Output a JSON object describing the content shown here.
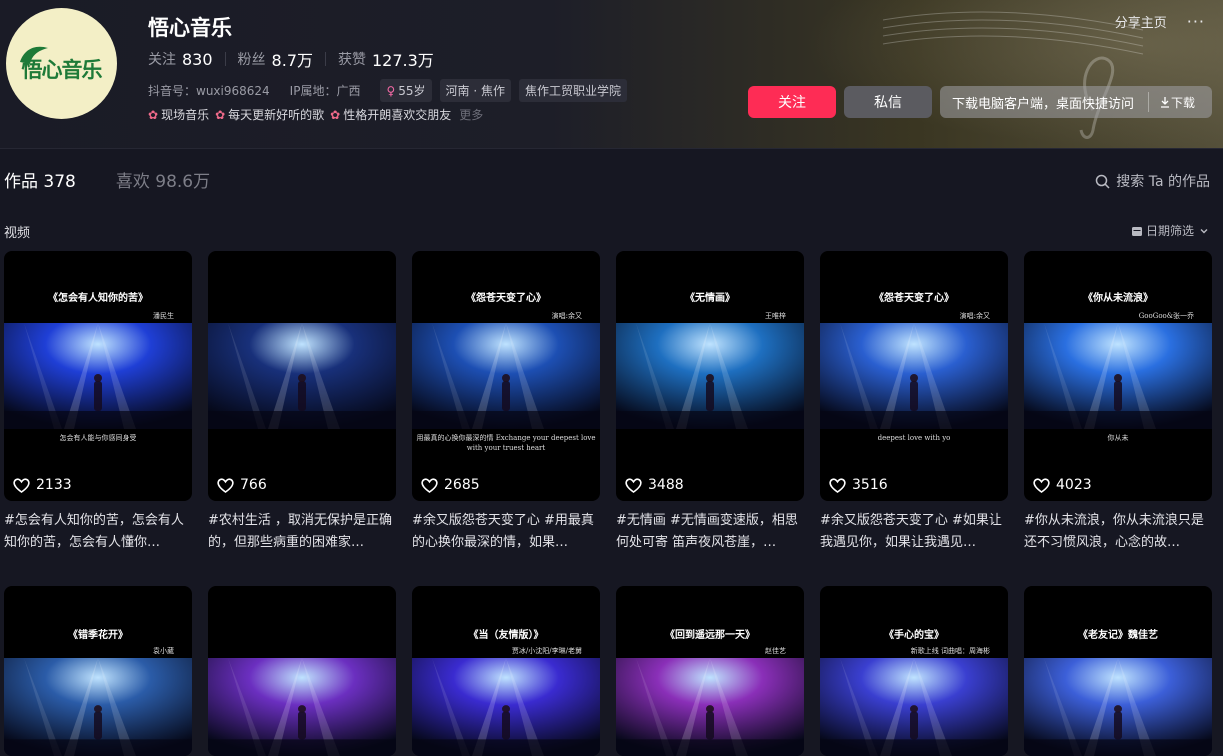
{
  "profile": {
    "name": "悟心音乐",
    "avatar_text": "悟心音乐",
    "stats": [
      {
        "label": "关注",
        "value": "830"
      },
      {
        "label": "粉丝",
        "value": "8.7万"
      },
      {
        "label": "获赞",
        "value": "127.3万"
      }
    ],
    "douyin_id": "抖音号：wuxi968624",
    "ip_location": "IP属地：广西",
    "tags": {
      "age": "55岁",
      "region": "河南 · 焦作",
      "school": "焦作工贸职业学院"
    },
    "bio_items": [
      "现场音乐",
      "每天更新好听的歌",
      "性格开朗喜欢交朋友"
    ],
    "bio_more": "更多"
  },
  "top_actions": {
    "share": "分享主页",
    "more": "···"
  },
  "buttons": {
    "follow": "关注",
    "message": "私信",
    "download_prompt": "下载电脑客户端，桌面快捷访问",
    "download": "下载"
  },
  "tabs": [
    {
      "label": "作品",
      "count": "378"
    },
    {
      "label": "喜欢",
      "count": "98.6万"
    }
  ],
  "search_works": "搜索 Ta 的作品",
  "section_label": "视频",
  "date_filter": "日期筛选",
  "videos": [
    {
      "likes": "2133",
      "desc": "#怎会有人知你的苦，怎会有人知你的苦，怎会有人懂你…",
      "art_title": "《怎会有人知你的苦》",
      "art_credit": "潘民生",
      "art_caption": "怎会有人能与你感同身受",
      "stage_color": "#1f3fd6"
    },
    {
      "likes": "766",
      "desc": "#农村生活 ，取消无保护是正确的，但那些病重的困难家…",
      "art_title": "",
      "art_credit": "",
      "art_caption": "",
      "stage_color": "#18307a"
    },
    {
      "likes": "2685",
      "desc": "#余又版怨苍天变了心 #用最真的心换你最深的情，如果…",
      "art_title": "《怨苍天变了心》",
      "art_credit": "演唱:余又",
      "art_caption": "用最真的心换你最深的情 Exchange your deepest love with your truest heart",
      "stage_color": "#1d4fb3"
    },
    {
      "likes": "3488",
      "desc": "#无情画 #无情画变速版，相思何处可寄 笛声夜风苍崖，…",
      "art_title": "《无情画》",
      "art_credit": "王唯梓",
      "art_caption": "",
      "stage_color": "#1e6fc0"
    },
    {
      "likes": "3516",
      "desc": "#余又版怨苍天变了心 #如果让我遇见你，如果让我遇见…",
      "art_title": "《怨苍天变了心》",
      "art_credit": "演唱:余又",
      "art_caption": "deepest love with yo",
      "stage_color": "#2a5fd0"
    },
    {
      "likes": "4023",
      "desc": "#你从未流浪，你从未流浪只是还不习惯风浪，心念的故…",
      "art_title": "《你从未流浪》",
      "art_credit": "GooGoo&张一乔",
      "art_caption": "你从未",
      "stage_color": "#2a6fe0"
    }
  ],
  "videos_row2": [
    {
      "art_title": "《错季花开》",
      "art_credit": "袁小葳",
      "stage_color": "#2b5ca8"
    },
    {
      "art_title": "",
      "art_credit": "",
      "stage_color": "#6b2fc0"
    },
    {
      "art_title": "《当（友情版）》",
      "art_credit": "贾冰/小沈阳/李琳/老舅",
      "stage_color": "#3a2bd0"
    },
    {
      "art_title": "《回到遥远那一天》",
      "art_credit": "赵佳艺",
      "stage_color": "#8a2fb8"
    },
    {
      "art_title": "《手心的宝》",
      "art_credit": "新歌上线 词曲唱：周海彬",
      "stage_color": "#3a3fd0"
    },
    {
      "art_title": "《老友记》魏佳艺",
      "art_credit": "",
      "stage_color": "#3c5fd8"
    }
  ]
}
